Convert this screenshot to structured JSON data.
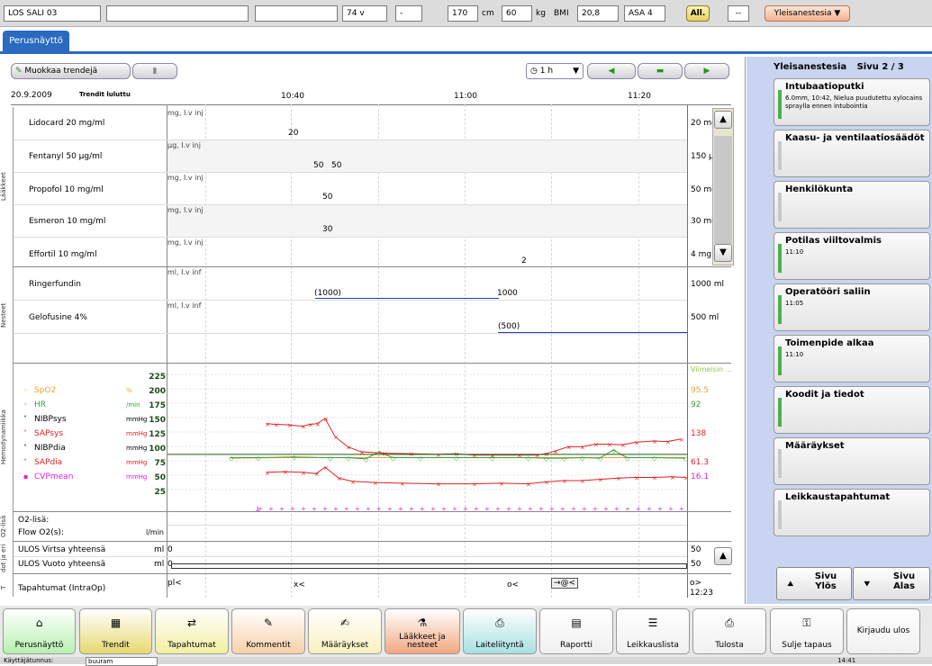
{
  "patient": {
    "name": "LOS SALI 03",
    "age": "74 v",
    "sex": "-",
    "height": "170",
    "height_unit": "cm",
    "weight": "60",
    "weight_unit": "kg",
    "bmi_label": "BMI",
    "bmi": "20,8",
    "asa": "ASA 4",
    "allergy_btn": "All.",
    "dash": "--",
    "anesthesia_btn": "Yleisanestesia ▼"
  },
  "tabs": {
    "main": "Perusnäyttö"
  },
  "toolbar": {
    "edit_trends": "Muokkaa trendejä",
    "range": "1 h",
    "date": "20.9.2009",
    "trends_read": "Trendit luluttu",
    "times": [
      "10:40",
      "11:00",
      "11:20"
    ]
  },
  "sections": {
    "meds": "Lääkkeet",
    "fluids": "Nesteet",
    "hemo": "Hemodynamiikka",
    "o2": "O2-lisä",
    "out": "dot ja eri",
    "t": "T"
  },
  "meds": [
    {
      "name": "Lidocard 20 mg/ml",
      "unit": "mg, I.v inj",
      "right": "20 mg",
      "marks": [
        "20"
      ]
    },
    {
      "name": "Fentanyl 50 µg/ml",
      "unit": "µg, I.v inj",
      "right": "150 µg",
      "marks": [
        "50",
        "50"
      ]
    },
    {
      "name": "Propofol 10 mg/ml",
      "unit": "mg, I.v inj",
      "right": "50 mg",
      "marks": [
        "50"
      ]
    },
    {
      "name": "Esmeron 10 mg/ml",
      "unit": "mg, I.v inj",
      "right": "30 mg",
      "marks": [
        "30"
      ]
    },
    {
      "name": "Effortil 10 mg/ml",
      "unit": "mg, I.v inj",
      "right": "4 mg",
      "marks": [
        "2"
      ]
    }
  ],
  "fluids": [
    {
      "name": "Ringerfundin",
      "unit": "ml, I.v inf",
      "right": "1000 ml",
      "marks": [
        "(1000)",
        "1000"
      ]
    },
    {
      "name": "Gelofusine 4%",
      "unit": "ml, I.v inf",
      "right": "500 ml",
      "marks": [
        "(500)"
      ]
    }
  ],
  "hemo": {
    "legend": [
      {
        "name": "SpO2",
        "unit": "%",
        "color": "#f0a030",
        "latest": "95.5"
      },
      {
        "name": "HR",
        "unit": "/min",
        "color": "#3a9a3a",
        "latest": "92"
      },
      {
        "name": "NIBPsys",
        "unit": "mmHg",
        "color": "#000000",
        "latest": ""
      },
      {
        "name": "SAPsys",
        "unit": "mmHg",
        "color": "#e02020",
        "latest": "138"
      },
      {
        "name": "NIBPdia",
        "unit": "mmHg",
        "color": "#000000",
        "latest": ""
      },
      {
        "name": "SAPdia",
        "unit": "mmHg",
        "color": "#e02020",
        "latest": "61.3"
      },
      {
        "name": "CVPmean",
        "unit": "mmHg",
        "color": "#e020e0",
        "latest": "16.1"
      }
    ],
    "scale": [
      "225",
      "200",
      "175",
      "150",
      "125",
      "100",
      "75",
      "50",
      "25"
    ],
    "latest_label": "Viimeisin ..."
  },
  "o2": {
    "row1": "O2-lisä:",
    "row2": "Flow O2(s):",
    "unit2": "l/min"
  },
  "outputs": [
    {
      "name": "ULOS Virtsa yhteensä",
      "unit": "ml",
      "val": "0",
      "right": "50"
    },
    {
      "name": "ULOS Vuoto yhteensä",
      "unit": "ml",
      "val": "0",
      "right": "50"
    }
  ],
  "events": {
    "name": "Tapahtumat (IntraOp)",
    "marks": [
      "pl<",
      "x<",
      "o<",
      "→@<"
    ],
    "right1": "o>",
    "right2": "12:23"
  },
  "rightpanel": {
    "title": "Yleisanestesia",
    "page": "Sivu 2 / 3",
    "cards": [
      {
        "title": "Intubaatioputki",
        "sub": "6.0mm, 10:42, Nielua puudutettu xylocains spraylla ennen intubointia",
        "green": true
      },
      {
        "title": "Kaasu- ja ventilaatiosäädöt",
        "sub": "",
        "green": false
      },
      {
        "title": "Henkilökunta",
        "sub": "",
        "green": false
      },
      {
        "title": "Potilas viiltovalmis",
        "sub": "11:10",
        "green": true
      },
      {
        "title": "Operatööri saliin",
        "sub": "11:05",
        "green": true
      },
      {
        "title": "Toimenpide alkaa",
        "sub": "11:10",
        "green": true
      },
      {
        "title": "Koodit ja tiedot",
        "sub": "",
        "green": true
      },
      {
        "title": "Määräykset",
        "sub": "",
        "green": false
      },
      {
        "title": "Leikkaustapahtumat",
        "sub": "",
        "green": false
      }
    ],
    "page_up": "Sivu Ylös",
    "page_down": "Sivu Alas"
  },
  "nav": [
    {
      "label": "Perusnäyttö",
      "icon": "home-icon",
      "glyph": "⌂",
      "color": "#b8f0b0"
    },
    {
      "label": "Trendit",
      "icon": "chart-icon",
      "glyph": "▦",
      "color": "#e8d870"
    },
    {
      "label": "Tapahtumat",
      "icon": "events-icon",
      "glyph": "⇄",
      "color": "#f0f0a0"
    },
    {
      "label": "Kommentit",
      "icon": "comment-icon",
      "glyph": "✎",
      "color": "#f8d0a8"
    },
    {
      "label": "Määräykset",
      "icon": "orders-icon",
      "glyph": "✍",
      "color": "#f8f0c0"
    },
    {
      "label": "Lääkkeet ja nesteet",
      "icon": "drug-icon",
      "glyph": "⚗",
      "color": "#f0a880"
    },
    {
      "label": "Laiteliityntä",
      "icon": "device-icon",
      "glyph": "⎙",
      "color": "#a8e0e0"
    },
    {
      "label": "Raportti",
      "icon": "report-icon",
      "glyph": "▤",
      "color": "#f0f0f0"
    },
    {
      "label": "Leikkauslista",
      "icon": "list-icon",
      "glyph": "☰",
      "color": "#f0f0f0"
    },
    {
      "label": "Tulosta",
      "icon": "print-icon",
      "glyph": "⎙",
      "color": "#f0f0f0"
    },
    {
      "label": "Sulje tapaus",
      "icon": "close-case-icon",
      "glyph": "⚿",
      "color": "#f0f0f0"
    },
    {
      "label": "Kirjaudu ulos",
      "icon": "logout-icon",
      "glyph": "",
      "color": "#f0f0f0"
    }
  ],
  "status": {
    "user_label": "Käyttäjätunnus:",
    "user": "buuram",
    "time": "14:41"
  }
}
